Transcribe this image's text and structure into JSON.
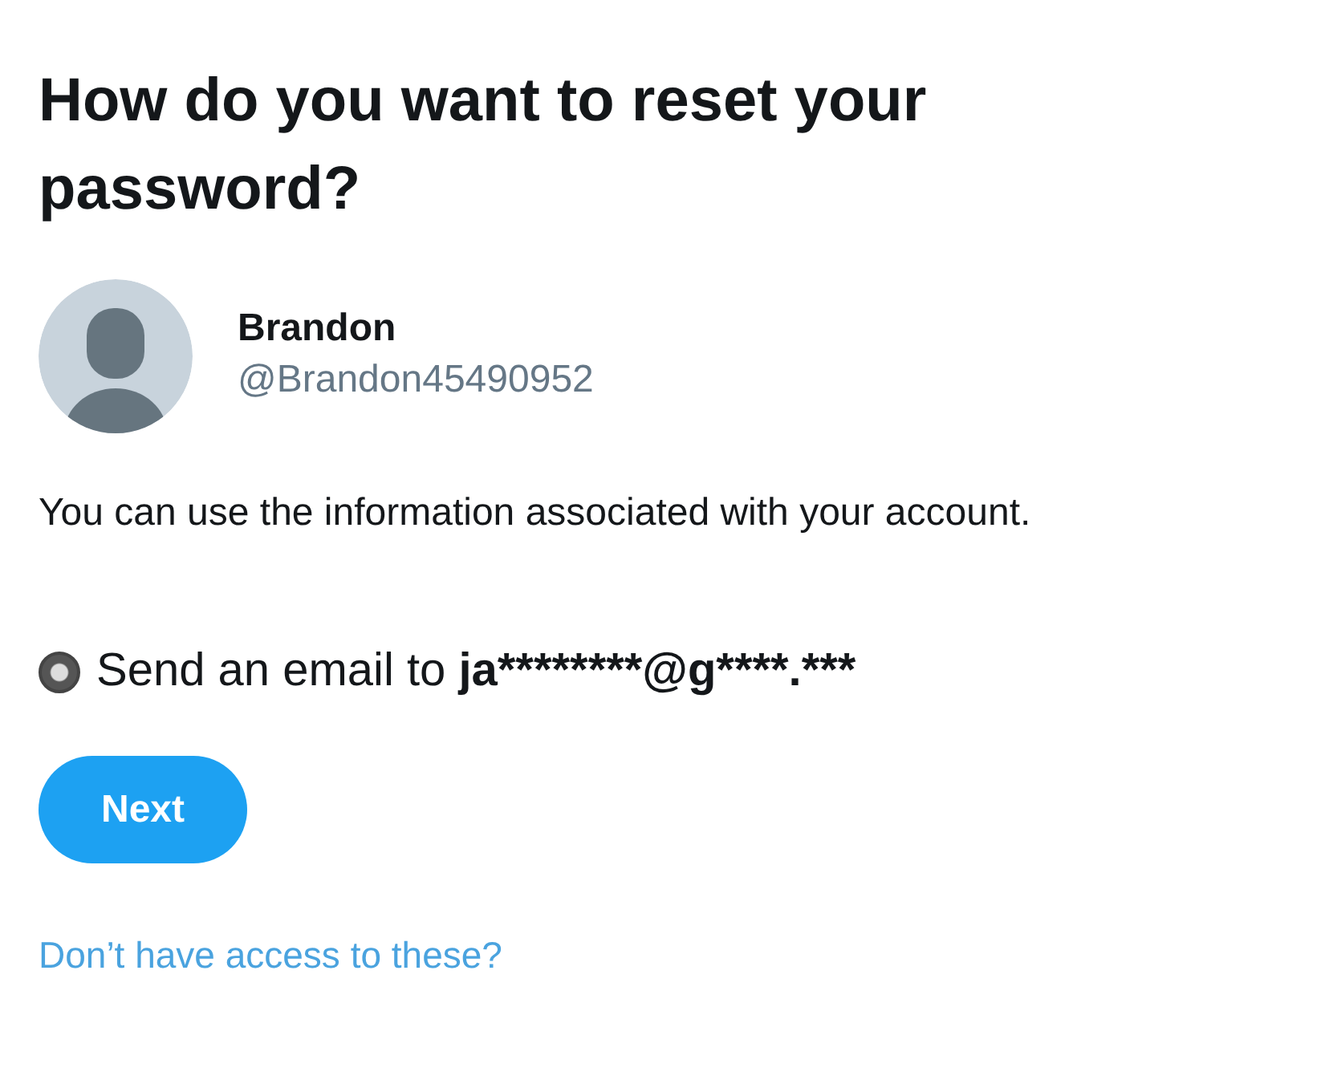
{
  "title": "How do you want to reset your password?",
  "account": {
    "name": "Brandon",
    "handle": "@Brandon45490952"
  },
  "info": "You can use the information associated with your account.",
  "options": [
    {
      "label": "Send an email to",
      "address": "ja********@g****.***",
      "selected": true
    }
  ],
  "next_button": "Next",
  "help_link": "Don’t have access to these?"
}
